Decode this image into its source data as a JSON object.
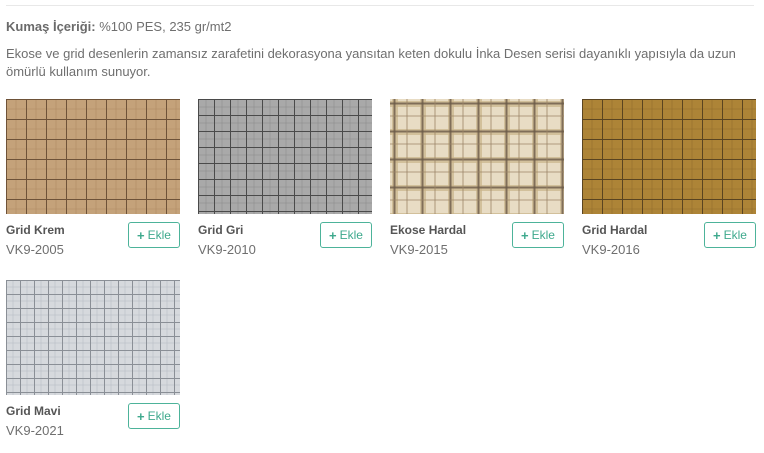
{
  "fabric": {
    "content_label": "Kumaş İçeriği:",
    "content_value": "%100 PES, 235 gr/mt2",
    "description": "Ekose ve grid desenlerin zamansız zarafetini dekorasyona yansıtan keten dokulu İnka Desen serisi dayanıklı yapısıyla da uzun ömürlü kullanım sunuyor."
  },
  "products": [
    {
      "name": "Grid Krem",
      "code": "VK9-2005",
      "add_label": "Ekle",
      "add_icon": "plus-icon",
      "colors": {
        "base": "#c4a27a",
        "line": "#6e5238",
        "fine": "#b08a62"
      }
    },
    {
      "name": "Grid Gri",
      "code": "VK9-2010",
      "add_label": "Ekle",
      "add_icon": "plus-icon",
      "colors": {
        "base": "#a9a9a9",
        "line": "#4a4a4a",
        "fine": "#8e8e8e"
      }
    },
    {
      "name": "Ekose Hardal",
      "code": "VK9-2015",
      "add_label": "Ekle",
      "add_icon": "plus-icon",
      "colors": {
        "base": "#e8dcc4",
        "line": "#6b5a48",
        "fine": "#c9b48a"
      }
    },
    {
      "name": "Grid Hardal",
      "code": "VK9-2016",
      "add_label": "Ekle",
      "add_icon": "plus-icon",
      "colors": {
        "base": "#ad8437",
        "line": "#5a4420",
        "fine": "#936d2b"
      }
    },
    {
      "name": "Grid Mavi",
      "code": "VK9-2021",
      "add_label": "Ekle",
      "add_icon": "plus-icon",
      "colors": {
        "base": "#d6d9dd",
        "line": "#8a8f96",
        "fine": "#b9bec6"
      }
    }
  ]
}
